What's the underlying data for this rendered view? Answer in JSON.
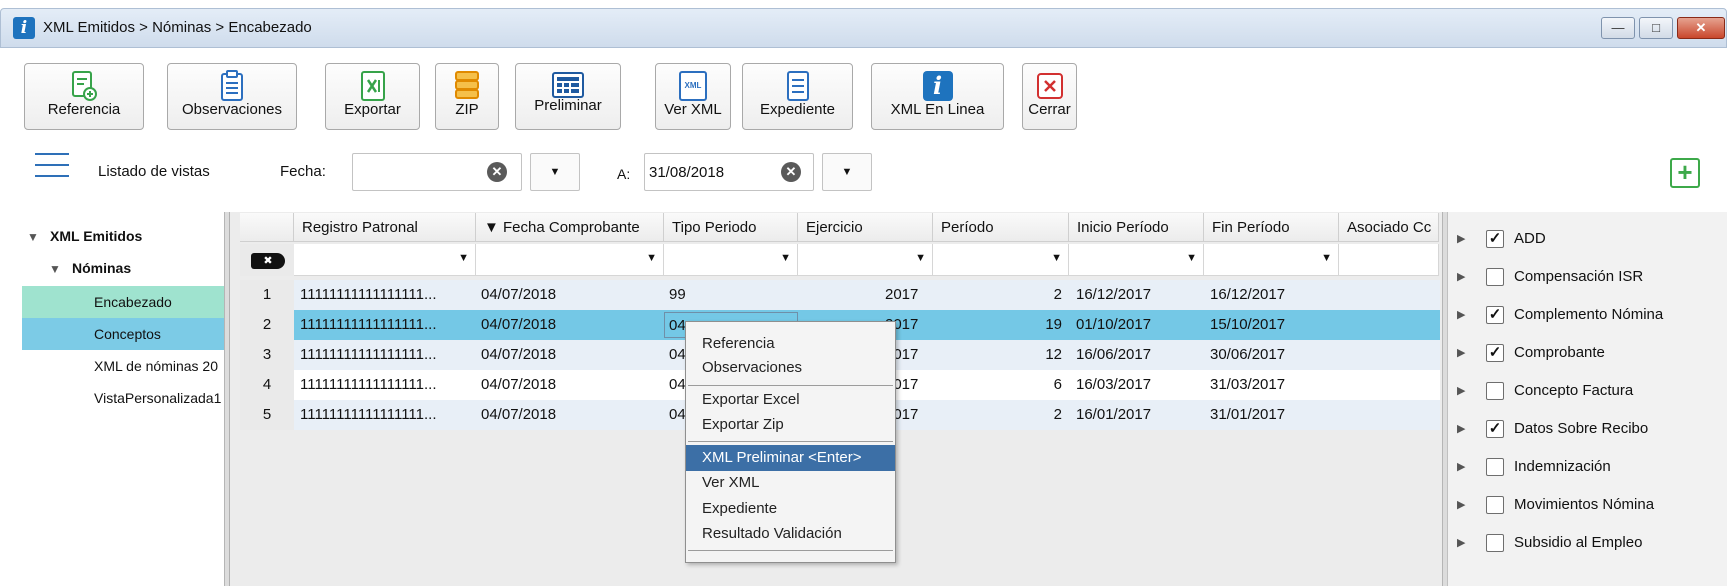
{
  "window": {
    "title": "XML Emitidos > Nóminas > Encabezado",
    "app_icon": "i",
    "controls": {
      "minimize": "—",
      "maximize": "□",
      "close": "✕"
    }
  },
  "toolbar": {
    "buttons": [
      {
        "label": "Referencia",
        "icon": "document-add-icon"
      },
      {
        "label": "Observaciones",
        "icon": "clipboard-icon"
      },
      {
        "label": "Exportar",
        "icon": "excel-export-icon"
      },
      {
        "label": "ZIP",
        "icon": "zip-stack-icon"
      },
      {
        "label": "Preliminar",
        "icon": "preview-grid-icon"
      },
      {
        "label": "Ver XML",
        "icon": "xml-file-icon"
      },
      {
        "label": "Expediente",
        "icon": "file-list-icon"
      },
      {
        "label": "XML En Linea",
        "icon": "info-icon"
      },
      {
        "label": "Cerrar",
        "icon": "close-box-icon"
      }
    ],
    "xml_icon_text": "XML"
  },
  "filters": {
    "views_label": "Listado de vistas",
    "fecha_label": "Fecha:",
    "fecha_value": "",
    "a_label": "A:",
    "a_value": "31/08/2018"
  },
  "tree": {
    "root": "XML Emitidos",
    "group": "Nóminas",
    "items": [
      "Encabezado",
      "Conceptos",
      "XML de nóminas 20",
      "VistaPersonalizada1"
    ]
  },
  "grid": {
    "columns": [
      "Registro Patronal",
      "▼ Fecha Comprobante",
      "Tipo Periodo",
      "Ejercicio",
      "Período",
      "Inicio Período",
      "Fin Período",
      "Asociado Cc"
    ],
    "clear_filter": "✖",
    "rows": [
      {
        "n": "1",
        "registro": "11111111111111111...",
        "fecha": "04/07/2018",
        "tipo": "99",
        "ejercicio": "2017",
        "periodo": "2",
        "inicio": "16/12/2017",
        "fin": "16/12/2017"
      },
      {
        "n": "2",
        "registro": "11111111111111111...",
        "fecha": "04/07/2018",
        "tipo": "04",
        "ejercicio": "2017",
        "periodo": "19",
        "inicio": "01/10/2017",
        "fin": "15/10/2017"
      },
      {
        "n": "3",
        "registro": "11111111111111111...",
        "fecha": "04/07/2018",
        "tipo": "04",
        "ejercicio": "2017",
        "periodo": "12",
        "inicio": "16/06/2017",
        "fin": "30/06/2017"
      },
      {
        "n": "4",
        "registro": "11111111111111111...",
        "fecha": "04/07/2018",
        "tipo": "04",
        "ejercicio": "2017",
        "periodo": "6",
        "inicio": "16/03/2017",
        "fin": "31/03/2017"
      },
      {
        "n": "5",
        "registro": "11111111111111111...",
        "fecha": "04/07/2018",
        "tipo": "04",
        "ejercicio": "2017",
        "periodo": "2",
        "inicio": "16/01/2017",
        "fin": "31/01/2017"
      }
    ],
    "selected_row": 2
  },
  "context_menu": {
    "items": [
      "Referencia",
      "Observaciones",
      "Exportar Excel",
      "Exportar Zip",
      "XML Preliminar <Enter>",
      "Ver XML",
      "Expediente",
      "Resultado Validación"
    ],
    "highlighted": "XML Preliminar <Enter>"
  },
  "right_panel": {
    "items": [
      {
        "label": "ADD",
        "checked": true
      },
      {
        "label": "Compensación ISR",
        "checked": false
      },
      {
        "label": "Complemento Nómina",
        "checked": true
      },
      {
        "label": "Comprobante",
        "checked": true
      },
      {
        "label": "Concepto Factura",
        "checked": false
      },
      {
        "label": "Datos Sobre Recibo",
        "checked": true
      },
      {
        "label": "Indemnización",
        "checked": false
      },
      {
        "label": "Movimientos Nómina",
        "checked": false
      },
      {
        "label": "Subsidio al Empleo",
        "checked": false
      }
    ],
    "check_mark": "✓"
  },
  "colors": {
    "accent_blue": "#2c6fbf",
    "green": "#37a34a",
    "selected_row": "#74c8e6",
    "tree_encabezado": "#9fe3cf",
    "tree_conceptos": "#7ccbe6",
    "menu_highlight": "#3c6fa6"
  }
}
